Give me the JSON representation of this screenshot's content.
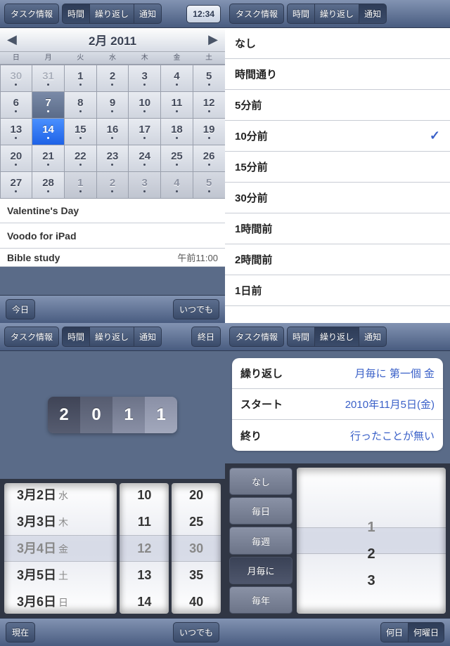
{
  "q1": {
    "tabs": [
      "タスク情報",
      "時間",
      "繰り返し",
      "通知"
    ],
    "tab_sel": 1,
    "clock": "12:34",
    "month_title": "2月 2011",
    "dow": [
      "日",
      "月",
      "火",
      "水",
      "木",
      "金",
      "土"
    ],
    "grid": [
      {
        "n": 30,
        "dim": 1
      },
      {
        "n": 31,
        "dim": 1
      },
      {
        "n": 1
      },
      {
        "n": 2
      },
      {
        "n": 3
      },
      {
        "n": 4
      },
      {
        "n": 5
      },
      {
        "n": 6
      },
      {
        "n": 7,
        "today": 1
      },
      {
        "n": 8
      },
      {
        "n": 9
      },
      {
        "n": 10
      },
      {
        "n": 11
      },
      {
        "n": 12
      },
      {
        "n": 13
      },
      {
        "n": 14,
        "sel": 1
      },
      {
        "n": 15
      },
      {
        "n": 16
      },
      {
        "n": 17
      },
      {
        "n": 18
      },
      {
        "n": 19
      },
      {
        "n": 20
      },
      {
        "n": 21
      },
      {
        "n": 22
      },
      {
        "n": 23
      },
      {
        "n": 24
      },
      {
        "n": 25
      },
      {
        "n": 26
      },
      {
        "n": 27
      },
      {
        "n": 28
      },
      {
        "n": 1,
        "inact": 1
      },
      {
        "n": 2,
        "inact": 1
      },
      {
        "n": 3,
        "inact": 1
      },
      {
        "n": 4,
        "inact": 1
      },
      {
        "n": 5,
        "inact": 1
      }
    ],
    "events": [
      {
        "t": "Valentine's Day"
      },
      {
        "t": "Voodo for iPad"
      },
      {
        "t": "Bible study",
        "time": "午前11:00",
        "half": 1
      }
    ],
    "bottom_left": "今日",
    "bottom_right": "いつでも"
  },
  "q2": {
    "tabs": [
      "タスク情報",
      "時間",
      "繰り返し",
      "通知"
    ],
    "tab_sel": 3,
    "options": [
      "なし",
      "時間通り",
      "5分前",
      "10分前",
      "15分前",
      "30分前",
      "1時間前",
      "2時間前",
      "1日前"
    ],
    "selected": 3
  },
  "q3": {
    "tabs": [
      "タスク情報",
      "時間",
      "繰り返し",
      "通知"
    ],
    "tab_sel": 1,
    "extra": "終日",
    "year": [
      "2",
      "0",
      "1",
      "1"
    ],
    "picker_date": [
      {
        "d": "3月2日",
        "w": "水"
      },
      {
        "d": "3月3日",
        "w": "木"
      },
      {
        "d": "3月4日",
        "w": "金",
        "c": 1
      },
      {
        "d": "3月5日",
        "w": "土"
      },
      {
        "d": "3月6日",
        "w": "日"
      }
    ],
    "picker_h": [
      "10",
      "11",
      "12",
      "13",
      "14"
    ],
    "picker_m": [
      "20",
      "25",
      "30",
      "35",
      "40"
    ],
    "bottom_left": "現在",
    "bottom_right": "いつでも"
  },
  "q4": {
    "tabs": [
      "タスク情報",
      "時間",
      "繰り返し",
      "通知"
    ],
    "tab_sel": 2,
    "rows": [
      {
        "l": "繰り返し",
        "v": "月毎に 第一個 金"
      },
      {
        "l": "スタート",
        "v": "2010年11月5日(金)"
      },
      {
        "l": "終り",
        "v": "行ったことが無い"
      }
    ],
    "freq": [
      "なし",
      "毎日",
      "毎週",
      "月毎に",
      "毎年"
    ],
    "freq_sel": 3,
    "picker": [
      "",
      "1",
      "2",
      "3"
    ],
    "bottom_left": "何日",
    "bottom_right": "何曜日",
    "bottom_sel": 1
  }
}
